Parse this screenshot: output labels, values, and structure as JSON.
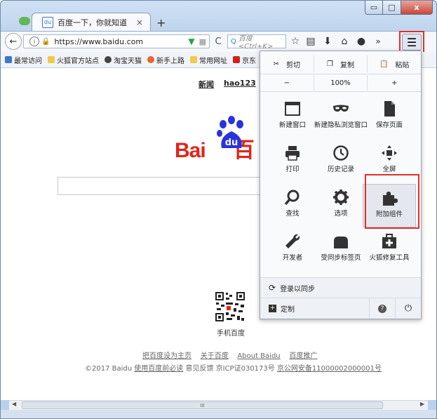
{
  "tab": {
    "title": "百度一下，你就知道",
    "favicon": "du",
    "close": "×",
    "new_tab": "+"
  },
  "window": {
    "minimize": "▭",
    "maximize": "□",
    "close": "x"
  },
  "nav": {
    "url": "https://www.baidu.com",
    "search_placeholder": "百度 <Ctrl+K>"
  },
  "bookmarks": [
    {
      "label": "最常访问",
      "color": "#3a78c9"
    },
    {
      "label": "火狐官方站点",
      "color": "#f2c94c"
    },
    {
      "label": "淘宝天猫",
      "color": "#444444"
    },
    {
      "label": "新手上路",
      "color": "#e8672a"
    },
    {
      "label": "常用网址",
      "color": "#f2c94c"
    },
    {
      "label": "京东",
      "color": "#d0201d"
    }
  ],
  "page": {
    "top_links": [
      "新闻",
      "hao123"
    ],
    "logo_left": "Bai",
    "logo_mid": "du",
    "logo_right": "百",
    "qr_label": "手机百度",
    "footer1": [
      "把百度设为主页",
      "关于百度",
      "About Baidu",
      "百度推广"
    ],
    "footer2_a": "©2017 Baidu ",
    "footer2_b": "使用百度前必读",
    "footer2_c": " 意见反馈 京ICP证030173号 ",
    "footer2_d": "京公网安备11000002000001号",
    "scroll_grip": "III"
  },
  "menu": {
    "cut": "剪切",
    "copy": "复制",
    "paste": "粘贴",
    "zoom_out": "−",
    "zoom_level": "100%",
    "zoom_in": "+",
    "items": [
      {
        "label": "新建窗口",
        "icon": "window-icon"
      },
      {
        "label": "新建隐私浏览窗口",
        "icon": "mask-icon"
      },
      {
        "label": "保存页面",
        "icon": "page-icon"
      },
      {
        "label": "打印",
        "icon": "printer-icon"
      },
      {
        "label": "历史记录",
        "icon": "clock-icon"
      },
      {
        "label": "全屏",
        "icon": "fullscreen-icon"
      },
      {
        "label": "查找",
        "icon": "magnifier-icon"
      },
      {
        "label": "选项",
        "icon": "gear-icon"
      },
      {
        "label": "附加组件",
        "icon": "puzzle-icon"
      },
      {
        "label": "开发者",
        "icon": "wrench-icon"
      },
      {
        "label": "受同步标签页",
        "icon": "tabs-icon"
      },
      {
        "label": "火狐修复工具",
        "icon": "medkit-icon"
      }
    ],
    "sync": "登录以同步",
    "customize": "定制",
    "highlight_color": "#e2302c"
  }
}
